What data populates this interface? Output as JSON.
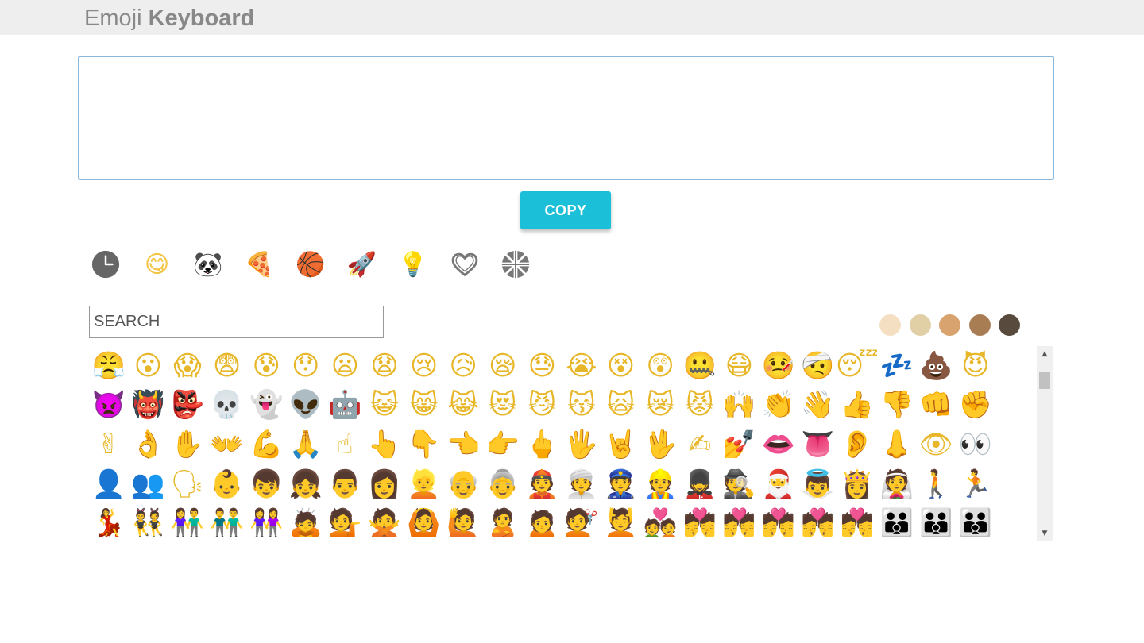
{
  "header": {
    "title_light": "Emoji",
    "title_bold": "Keyboard"
  },
  "editor": {
    "value": "",
    "placeholder": ""
  },
  "copy_button": {
    "label": "COPY"
  },
  "categories": [
    {
      "name": "recent-category",
      "icon": "clock-icon"
    },
    {
      "name": "people-category",
      "icon": "face-icon",
      "glyph": "😋"
    },
    {
      "name": "nature-category",
      "icon": "bear-icon",
      "glyph": "🐼"
    },
    {
      "name": "food-category",
      "icon": "pizza-icon",
      "glyph": "🍕"
    },
    {
      "name": "activity-category",
      "icon": "basketball-icon",
      "glyph": "🏀"
    },
    {
      "name": "travel-category",
      "icon": "rocket-icon",
      "glyph": "🚀"
    },
    {
      "name": "objects-category",
      "icon": "lightbulb-icon",
      "glyph": "💡"
    },
    {
      "name": "symbols-category",
      "icon": "heart-icon",
      "glyph": "♡"
    },
    {
      "name": "flags-category",
      "icon": "flag-icon",
      "glyph": "⚑"
    }
  ],
  "search": {
    "placeholder": "SEARCH"
  },
  "skin_tones": [
    "#f5dfc2",
    "#e1cfa6",
    "#d9a36f",
    "#a97d53",
    "#584b3d"
  ],
  "emoji_rows": [
    [
      "😤",
      "😮",
      "😱",
      "😨",
      "😰",
      "😯",
      "😦",
      "😧",
      "😢",
      "😥",
      "😪",
      "😓",
      "😭",
      "😵",
      "😲",
      "🤐",
      "😷",
      "🤒",
      "🤕",
      "😴",
      "💤",
      "💩",
      "😈",
      "👿"
    ],
    [
      "👹",
      "👺",
      "💀",
      "👻",
      "👽",
      "🤖",
      "😺",
      "😸",
      "😹",
      "😻",
      "😼",
      "😽",
      "🙀",
      "😿",
      "😾",
      "🙌",
      "👏",
      "👋",
      "👍",
      "👎",
      "👊",
      "✊",
      "✌",
      "👌"
    ],
    [
      "✋",
      "👐",
      "💪",
      "🙏",
      "☝",
      "👆",
      "👇",
      "👈",
      "👉",
      "🖕",
      "🖐",
      "🤘",
      "🖖",
      "✍",
      "💅",
      "👄",
      "👅",
      "👂",
      "👃",
      "👁",
      "👀",
      "👤",
      "👥",
      "🗣"
    ],
    [
      "👶",
      "👦",
      "👧",
      "👨",
      "👩",
      "👱",
      "👴",
      "👵",
      "👲",
      "👳",
      "👮",
      "👷",
      "💂",
      "🕵",
      "🎅",
      "👼",
      "👸",
      "👰",
      "🚶",
      "🏃",
      "💃",
      "👯",
      "👫",
      "👬"
    ],
    [
      "👭",
      "🙇",
      "💁",
      "🙅",
      "🙆",
      "🙋",
      "🙎",
      "🙍",
      "💇",
      "💆",
      "💑",
      "💏",
      "💏",
      "💏",
      "💏",
      "💏",
      "👪",
      "👪",
      "👪",
      "👪",
      "👪",
      "👪",
      "👪",
      "👪"
    ]
  ]
}
